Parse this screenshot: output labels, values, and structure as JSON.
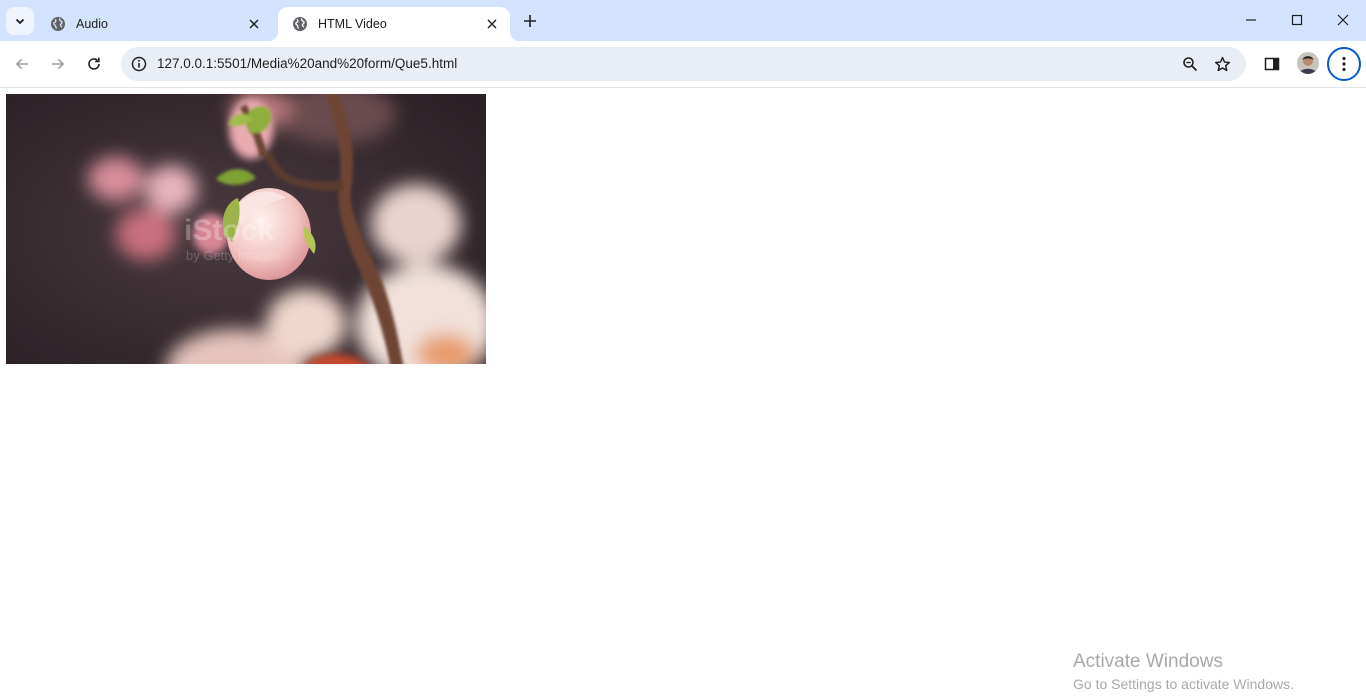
{
  "tabs": [
    {
      "title": "Audio",
      "favicon": "globe-icon",
      "active": false
    },
    {
      "title": "HTML Video",
      "favicon": "globe-icon",
      "active": true
    }
  ],
  "address_bar": {
    "url": "127.0.0.1:5501/Media%20and%20form/Que5.html",
    "site_info_icon": "info-icon"
  },
  "toolbar_icons": [
    "back-icon",
    "forward-icon",
    "reload-icon",
    "zoom-icon",
    "star-icon",
    "side-panel-icon",
    "avatar",
    "kebab-menu-icon"
  ],
  "video": {
    "watermark_brand": "iStock",
    "watermark_sub": "by Getty Images"
  },
  "watermark": {
    "line1": "Activate Windows",
    "line2": "Go to Settings to activate Windows."
  },
  "colors": {
    "tabstrip": "#d3e3fd",
    "omnibox": "#e9eef6",
    "accent": "#0b57d0"
  }
}
